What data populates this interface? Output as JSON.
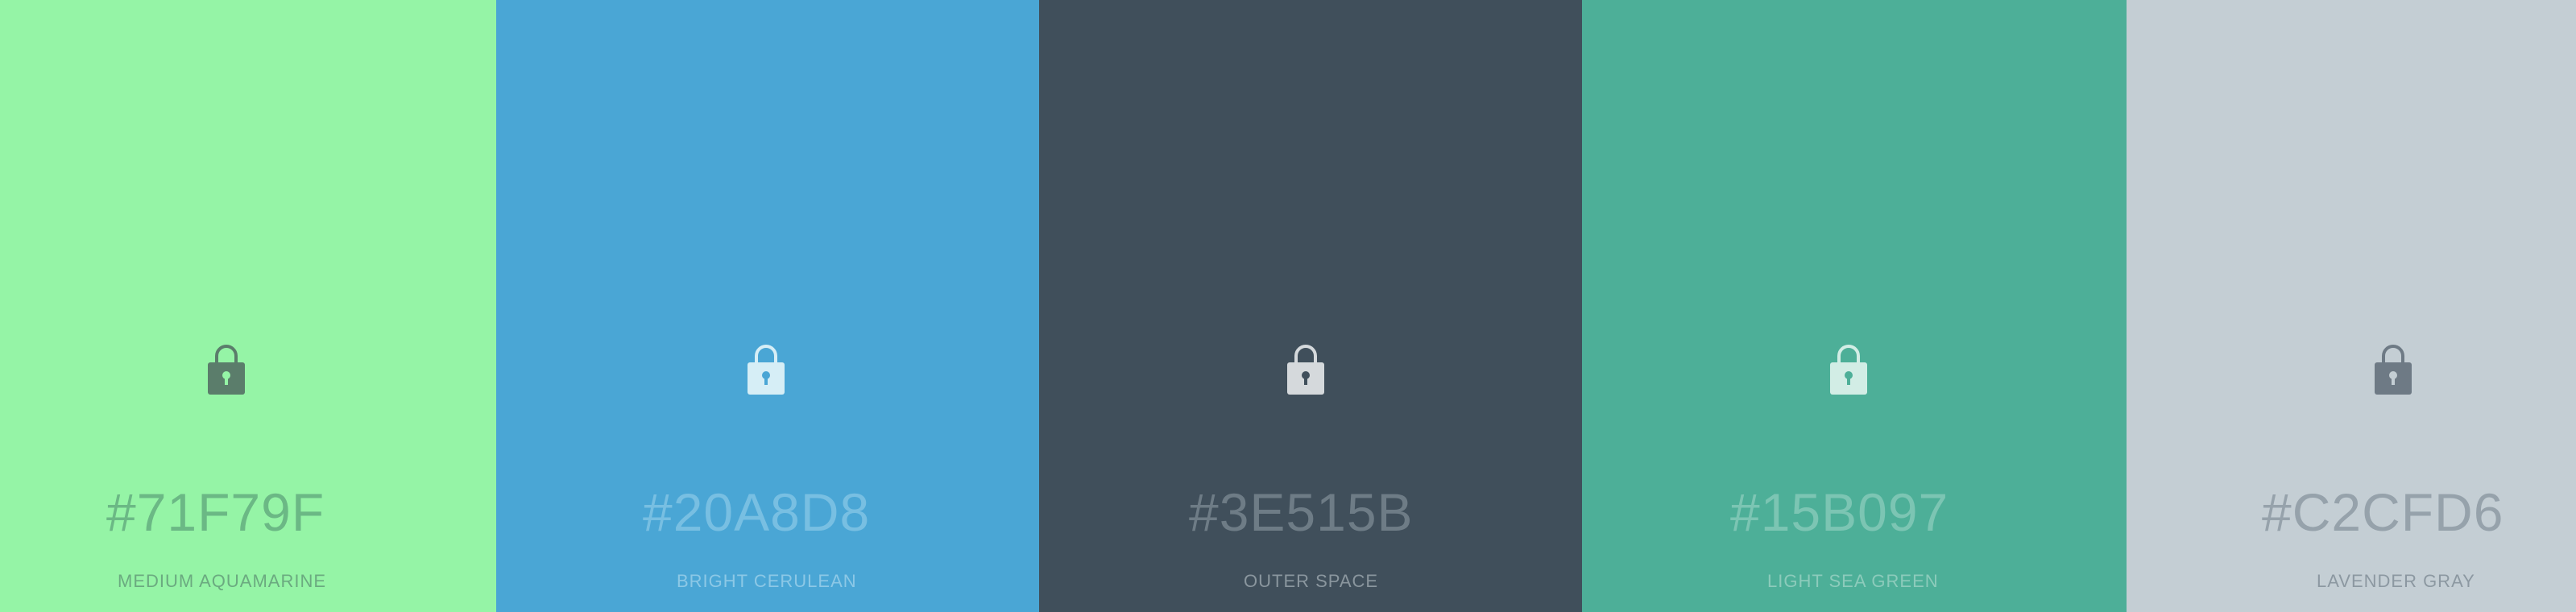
{
  "palette": {
    "swatches": [
      {
        "hex": "#71F79F",
        "name": "MEDIUM AQUAMARINE",
        "background": "#95F4A6",
        "lock_body": "#5B7D6B",
        "lock_keyhole": "#95F4A6",
        "hex_text_color": "#6BB885",
        "name_text_color": "#6BAA80",
        "icon": "lock-icon"
      },
      {
        "hex": "#20A8D8",
        "name": "BRIGHT CERULEAN",
        "background": "#4AA6D5",
        "lock_body": "#D6EEF6",
        "lock_keyhole": "#4AA6D5",
        "hex_text_color": "#78BFE2",
        "name_text_color": "#8CC8E6",
        "icon": "lock-icon"
      },
      {
        "hex": "#3E515B",
        "name": "OUTER SPACE",
        "background": "#404F5B",
        "lock_body": "#D5D9DC",
        "lock_keyhole": "#404F5B",
        "hex_text_color": "#6E7C86",
        "name_text_color": "#8A969E",
        "icon": "lock-icon"
      },
      {
        "hex": "#15B097",
        "name": "LIGHT SEA GREEN",
        "background": "#4DAF98",
        "lock_body": "#D2EDE5",
        "lock_keyhole": "#4DAF98",
        "hex_text_color": "#7CC5B3",
        "name_text_color": "#8CCBBB",
        "icon": "lock-icon"
      },
      {
        "hex": "#C2CFD6",
        "name": "LAVENDER GRAY",
        "background": "#C4CED4",
        "lock_body": "#6E7A85",
        "lock_keyhole": "#C4CED4",
        "hex_text_color": "#96A2AB",
        "name_text_color": "#8C98A1",
        "icon": "lock-icon"
      }
    ]
  }
}
